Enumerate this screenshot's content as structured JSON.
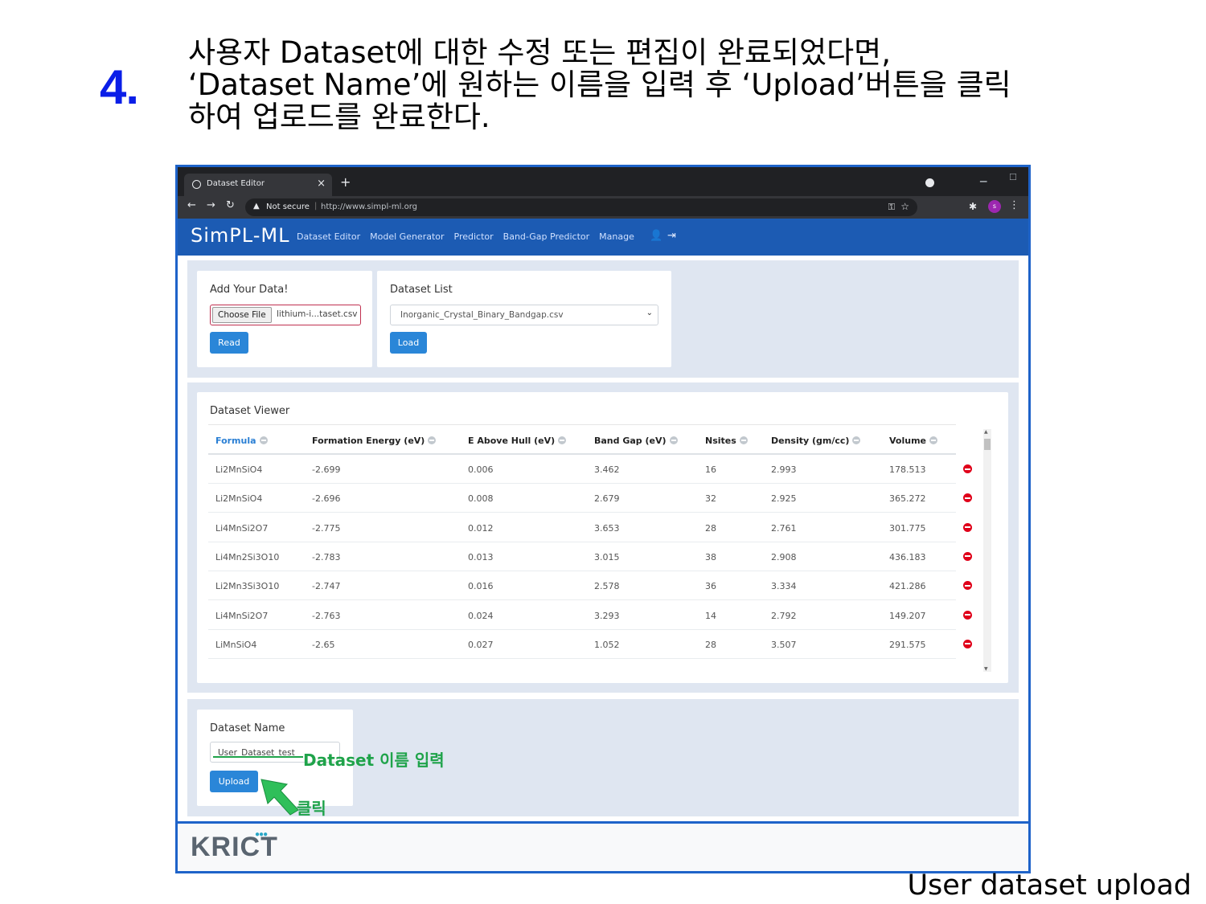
{
  "slide": {
    "step": "4.",
    "instruction_lines": [
      "사용자 Dataset에 대한 수정 또는 편집이 완료되었다면,",
      "‘Dataset Name’에 원하는 이름을 입력 후 ‘Upload’버튼을 클릭",
      "하여 업로드를 완료한다."
    ],
    "caption": "User dataset upload"
  },
  "browser": {
    "tab_title": "Dataset Editor",
    "tab_close": "×",
    "new_tab": "+",
    "not_secure": "Not secure",
    "separator": "|",
    "url": "http://www.simpl-ml.org",
    "profile_initial": "s"
  },
  "app": {
    "brand": "SimPL-ML",
    "nav": [
      "Dataset Editor",
      "Model Generator",
      "Predictor",
      "Band-Gap Predictor",
      "Manage"
    ]
  },
  "add_data": {
    "title": "Add Your Data!",
    "choose_label": "Choose File",
    "file_name": "lithium-i...taset.csv",
    "read_label": "Read"
  },
  "dataset_list": {
    "title": "Dataset List",
    "selected": "Inorganic_Crystal_Binary_Bandgap.csv",
    "load_label": "Load"
  },
  "viewer": {
    "title": "Dataset Viewer",
    "columns": [
      "Formula",
      "Formation Energy (eV)",
      "E Above Hull (eV)",
      "Band Gap (eV)",
      "Nsites",
      "Density (gm/cc)",
      "Volume"
    ],
    "rows": [
      [
        "Li2MnSiO4",
        "-2.699",
        "0.006",
        "3.462",
        "16",
        "2.993",
        "178.513"
      ],
      [
        "Li2MnSiO4",
        "-2.696",
        "0.008",
        "2.679",
        "32",
        "2.925",
        "365.272"
      ],
      [
        "Li4MnSi2O7",
        "-2.775",
        "0.012",
        "3.653",
        "28",
        "2.761",
        "301.775"
      ],
      [
        "Li4Mn2Si3O10",
        "-2.783",
        "0.013",
        "3.015",
        "38",
        "2.908",
        "436.183"
      ],
      [
        "Li2Mn3Si3O10",
        "-2.747",
        "0.016",
        "2.578",
        "36",
        "3.334",
        "421.286"
      ],
      [
        "Li4MnSi2O7",
        "-2.763",
        "0.024",
        "3.293",
        "14",
        "2.792",
        "149.207"
      ],
      [
        "LiMnSiO4",
        "-2.65",
        "0.027",
        "1.052",
        "28",
        "3.507",
        "291.575"
      ]
    ]
  },
  "dataset_name": {
    "title": "Dataset Name",
    "value": "User_Dataset_test",
    "upload_label": "Upload"
  },
  "annotations": {
    "input_note": "Dataset 이름 입력",
    "click_note": "클릭",
    "color": "#1fa34a"
  },
  "footer": {
    "logo": "KRICT"
  },
  "colors": {
    "navbar": "#1c5bb3",
    "button": "#2a86d8",
    "frame": "#1e63c9",
    "step": "#0a1ee8",
    "delete": "#e0001a"
  }
}
